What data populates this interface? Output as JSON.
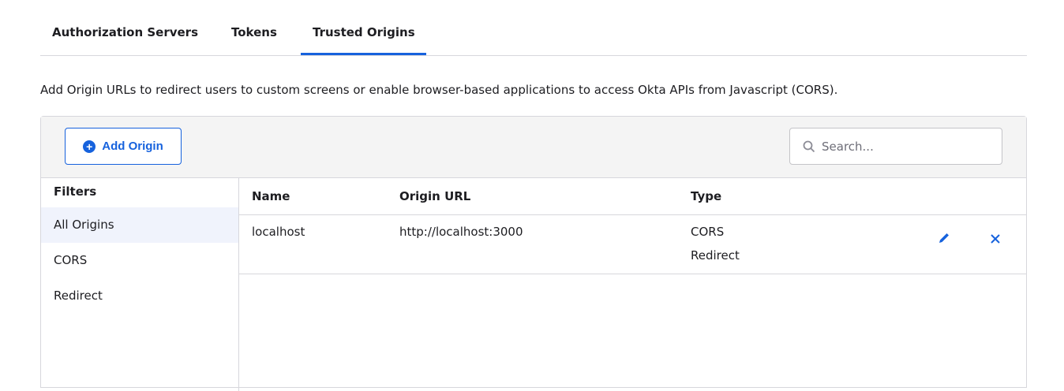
{
  "tabs": [
    {
      "label": "Authorization Servers"
    },
    {
      "label": "Tokens"
    },
    {
      "label": "Trusted Origins",
      "active": true
    }
  ],
  "description": "Add Origin URLs to redirect users to custom screens or enable browser-based applications to access Okta APIs from Javascript (CORS).",
  "toolbar": {
    "add_label": "Add Origin",
    "search_placeholder": "Search..."
  },
  "filters": {
    "title": "Filters",
    "items": [
      {
        "label": "All Origins",
        "selected": true
      },
      {
        "label": "CORS"
      },
      {
        "label": "Redirect"
      }
    ]
  },
  "table": {
    "headers": [
      "Name",
      "Origin URL",
      "Type"
    ],
    "rows": [
      {
        "name": "localhost",
        "url": "http://localhost:3000",
        "types": [
          "CORS",
          "Redirect"
        ]
      }
    ]
  },
  "colors": {
    "accent": "#1662dd"
  }
}
